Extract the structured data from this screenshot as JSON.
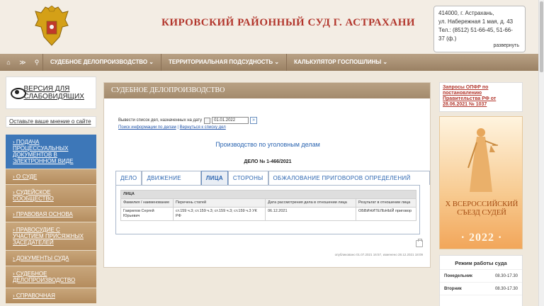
{
  "header": {
    "court_title": "КИРОВСКИЙ РАЙОННЫЙ СУД Г. АСТРАХАНИ",
    "address": {
      "line1": "414000, г. Астрахань,",
      "line2": "ул. Набережная 1 мая, д. 43",
      "line3": "Тел.: (8512) 51-66-45, 51-66-",
      "line4": "37 (ф.)",
      "expand_label": "развернуть"
    }
  },
  "nav": {
    "items": [
      {
        "label": "СУДЕБНОЕ ДЕЛОПРОИЗВОДСТВО ⌄"
      },
      {
        "label": "ТЕРРИТОРИАЛЬНАЯ ПОДСУДНОСТЬ ⌄"
      },
      {
        "label": "КАЛЬКУЛЯТОР ГОСПОШЛИНЫ ⌄"
      }
    ]
  },
  "left": {
    "blind_version_label": "ВЕРСИЯ ДЛЯ СЛАБОВИДЯЩИХ",
    "feedback_label": "Оставьте ваше мнение о сайте",
    "menu": [
      {
        "label": "› ПОДАЧА ПРОЦЕССУАЛЬНЫХ ДОКУМЕНТОВ В ЭЛЕКТРОННОМ ВИДЕ"
      },
      {
        "label": "› О СУДЕ"
      },
      {
        "label": "› СУДЕЙСКОЕ СООБЩЕСТВО"
      },
      {
        "label": "› ПРАВОВАЯ ОСНОВА"
      },
      {
        "label": "› ПРАВОСУДИЕ С УЧАСТИЕМ ПРИСЯЖНЫХ ЗАСЕДАТЕЛЕЙ"
      },
      {
        "label": "› ДОКУМЕНТЫ СУДА"
      },
      {
        "label": "› СУДЕБНОЕ ДЕЛОПРОИЗВОДСТВО"
      },
      {
        "label": "› СПРАВОЧНАЯ"
      }
    ]
  },
  "main": {
    "heading": "СУДЕБНОЕ ДЕЛОПРОИЗВОДСТВО",
    "date_label": "Вывести список дел, назначенных на дату",
    "date_value": "01.01.2022",
    "go_label": "»",
    "link_search": "Поиск информации по делам",
    "link_separator": "|",
    "link_back": "Вернуться к списку дел",
    "case_category": "Производство по уголовным делам",
    "case_number": "ДЕЛО № 1-466/2021",
    "tabs": [
      {
        "label": "ДЕЛО"
      },
      {
        "label": "ДВИЖЕНИЕ ДЕЛА"
      },
      {
        "label": "ЛИЦА"
      },
      {
        "label": "СТОРОНЫ"
      },
      {
        "label": "ОБЖАЛОВАНИЕ ПРИГОВОРОВ ОПРЕДЕЛЕНИЙ (ПОСТ.)"
      }
    ],
    "persons_table": {
      "caption": "ЛИЦА",
      "columns": [
        "Фамилия / наименование",
        "Перечень статей",
        "Дата рассмотрения дела в отношении лица",
        "Результат в отношении лица"
      ],
      "rows": [
        [
          "Гаврилов Сергей Юрьевич",
          "ст.159 ч.3; ст.159 ч.3; ст.159 ч.3; ст.159 ч.3 УК РФ",
          "06.12.2021",
          "ОБВИНИТЕЛЬНЫЙ приговор"
        ]
      ]
    },
    "published": "опубликовано 01.07.2021 16:57, изменено 28.12.2021 18:09"
  },
  "right": {
    "opfr_link": "Запросы ОПФР по постановлению Правительства РФ от 28.06.2021 № 1037",
    "banner": {
      "line1": "X ВСЕРОССИЙСКИЙ",
      "line2": "СЪЕЗД СУДЕЙ",
      "year": "· 2022 ·"
    },
    "schedule": {
      "title": "Режим работы суда",
      "rows": [
        {
          "day": "Понедельник",
          "hours": "08.30-17.30"
        },
        {
          "day": "Вторник",
          "hours": "08.30-17.30"
        }
      ]
    }
  }
}
